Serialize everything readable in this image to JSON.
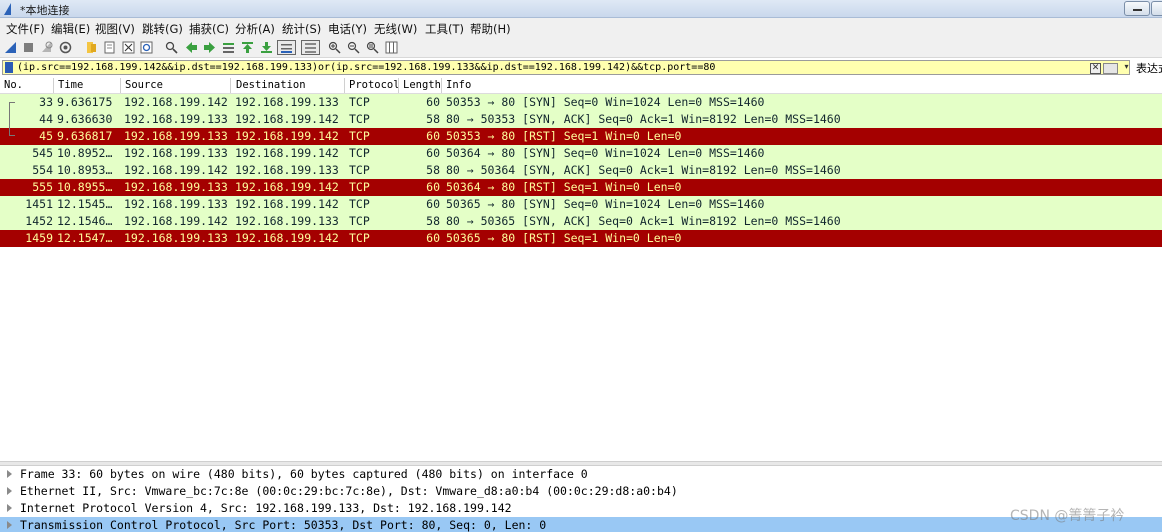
{
  "window": {
    "title": "*本地连接"
  },
  "menu": [
    "文件(F)",
    "编辑(E)",
    "视图(V)",
    "跳转(G)",
    "捕获(C)",
    "分析(A)",
    "统计(S)",
    "电话(Y)",
    "无线(W)",
    "工具(T)",
    "帮助(H)"
  ],
  "toolbar_icons": [
    "start-capture-icon",
    "stop-capture-icon",
    "restart-capture-icon",
    "capture-options-icon",
    "open-file-icon",
    "save-file-icon",
    "close-file-icon",
    "reload-file-icon",
    "find-packet-icon",
    "go-back-icon",
    "go-forward-icon",
    "go-to-packet-icon",
    "go-first-icon",
    "go-last-icon",
    "auto-scroll-icon",
    "colorize-icon",
    "zoom-in-icon",
    "zoom-out-icon",
    "zoom-normal-icon",
    "resize-columns-icon"
  ],
  "filter": {
    "value": "(ip.src==192.168.199.142&&ip.dst==192.168.199.133)or(ip.src==192.168.199.133&&ip.dst==192.168.199.142)&&tcp.port==80",
    "expression_label": "表达式"
  },
  "columns": [
    "No.",
    "Time",
    "Source",
    "Destination",
    "Protocol",
    "Length",
    "Info"
  ],
  "packets": [
    {
      "no": "33",
      "time": "9.636175",
      "source": "192.168.199.142",
      "destination": "192.168.199.133",
      "protocol": "TCP",
      "length": "60",
      "info": "50353 → 80 [SYN] Seq=0 Win=1024 Len=0 MSS=1460",
      "type": "syn"
    },
    {
      "no": "44",
      "time": "9.636630",
      "source": "192.168.199.133",
      "destination": "192.168.199.142",
      "protocol": "TCP",
      "length": "58",
      "info": "80 → 50353 [SYN, ACK] Seq=0 Ack=1 Win=8192 Len=0 MSS=1460",
      "type": "syn"
    },
    {
      "no": "45",
      "time": "9.636817",
      "source": "192.168.199.133",
      "destination": "192.168.199.142",
      "protocol": "TCP",
      "length": "60",
      "info": "50353 → 80 [RST] Seq=1 Win=0 Len=0",
      "type": "rst"
    },
    {
      "no": "545",
      "time": "10.8952…",
      "source": "192.168.199.133",
      "destination": "192.168.199.142",
      "protocol": "TCP",
      "length": "60",
      "info": "50364 → 80 [SYN] Seq=0 Win=1024 Len=0 MSS=1460",
      "type": "syn"
    },
    {
      "no": "554",
      "time": "10.8953…",
      "source": "192.168.199.142",
      "destination": "192.168.199.133",
      "protocol": "TCP",
      "length": "58",
      "info": "80 → 50364 [SYN, ACK] Seq=0 Ack=1 Win=8192 Len=0 MSS=1460",
      "type": "syn"
    },
    {
      "no": "555",
      "time": "10.8955…",
      "source": "192.168.199.133",
      "destination": "192.168.199.142",
      "protocol": "TCP",
      "length": "60",
      "info": "50364 → 80 [RST] Seq=1 Win=0 Len=0",
      "type": "rst"
    },
    {
      "no": "1451",
      "time": "12.1545…",
      "source": "192.168.199.133",
      "destination": "192.168.199.142",
      "protocol": "TCP",
      "length": "60",
      "info": "50365 → 80 [SYN] Seq=0 Win=1024 Len=0 MSS=1460",
      "type": "syn"
    },
    {
      "no": "1452",
      "time": "12.1546…",
      "source": "192.168.199.142",
      "destination": "192.168.199.133",
      "protocol": "TCP",
      "length": "58",
      "info": "80 → 50365 [SYN, ACK] Seq=0 Ack=1 Win=8192 Len=0 MSS=1460",
      "type": "syn"
    },
    {
      "no": "1459",
      "time": "12.1547…",
      "source": "192.168.199.133",
      "destination": "192.168.199.142",
      "protocol": "TCP",
      "length": "60",
      "info": "50365 → 80 [RST] Seq=1 Win=0 Len=0",
      "type": "rst"
    }
  ],
  "details": [
    {
      "text": "Frame 33: 60 bytes on wire (480 bits), 60 bytes captured (480 bits) on interface 0",
      "selected": false
    },
    {
      "text": "Ethernet II, Src: Vmware_bc:7c:8e (00:0c:29:bc:7c:8e), Dst: Vmware_d8:a0:b4 (00:0c:29:d8:a0:b4)",
      "selected": false
    },
    {
      "text": "Internet Protocol Version 4, Src: 192.168.199.133, Dst: 192.168.199.142",
      "selected": false
    },
    {
      "text": "Transmission Control Protocol, Src Port: 50353, Dst Port: 80, Seq: 0, Len: 0",
      "selected": true
    }
  ],
  "colors": {
    "syn_row_bg": "#e4ffc7",
    "rst_row_bg": "#a40000",
    "rst_row_fg": "#fffc9c",
    "filter_bg": "#ffffaf",
    "selected_detail_bg": "#99c8f4"
  },
  "watermark": "CSDN @箐箐子衿"
}
